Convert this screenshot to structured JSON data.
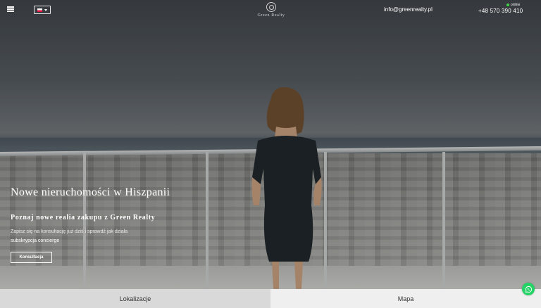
{
  "header": {
    "menu_icon": "hamburger-icon",
    "language": {
      "selected": "PL",
      "flag_icon": "poland-flag-icon"
    },
    "logo_text": "Green Realty",
    "email": "info@greenrealty.pl",
    "online_label": "online",
    "phone": "+48 570 390 410"
  },
  "hero": {
    "title": "Nowe nieruchomości w Hiszpanii",
    "subtitle": "Poznaj nowe realia zakupu z Green Realty",
    "description": "Zapisz się na konsultację już dziś i sprawdź jak działa",
    "link_text": "subskrypcja concierge",
    "button_label": "Konsultacja"
  },
  "tabs": [
    {
      "label": "Lokalizacje"
    },
    {
      "label": "Mapa"
    }
  ],
  "floating": {
    "whatsapp_icon": "whatsapp-icon"
  },
  "colors": {
    "online_dot": "#47d147",
    "whatsapp": "#25d366",
    "tab_left_bg": "#d9d9d9",
    "tab_right_bg": "#efefef"
  }
}
